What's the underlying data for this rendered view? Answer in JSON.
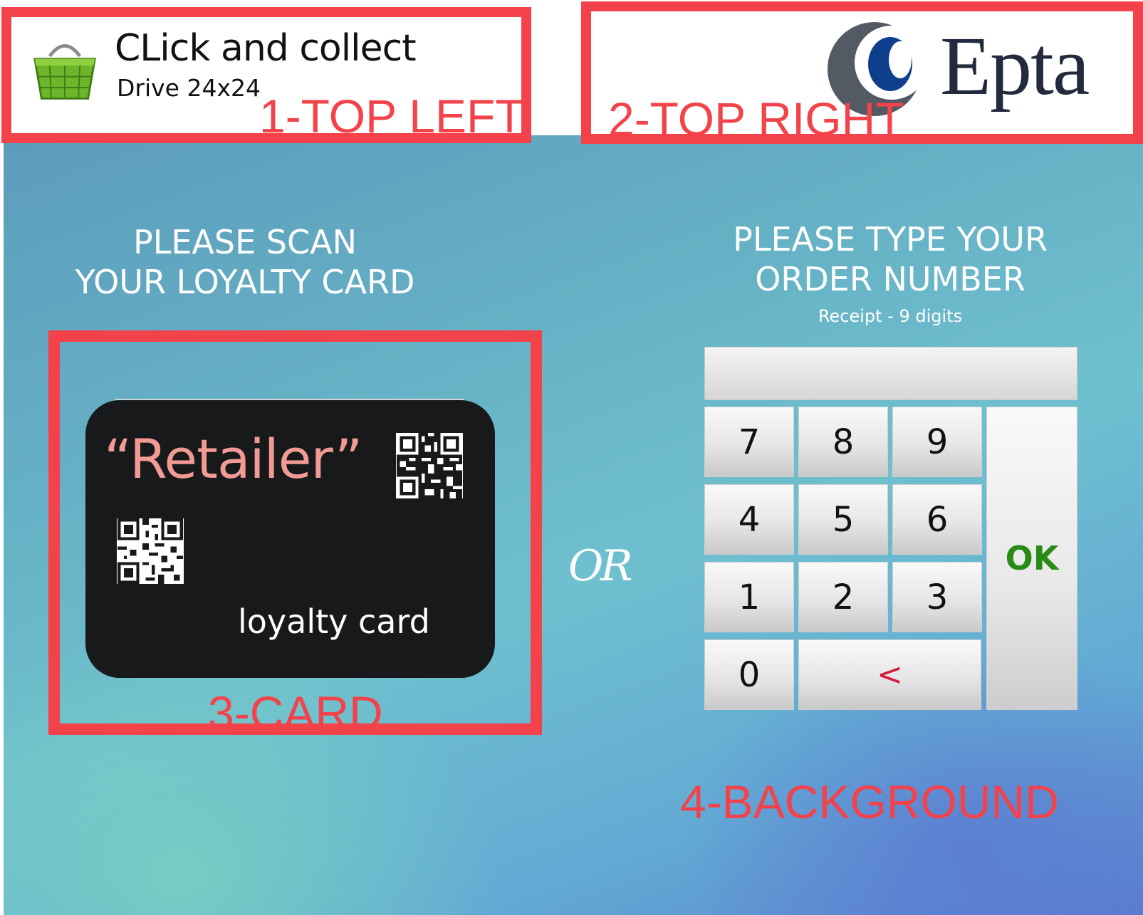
{
  "header": {
    "app_title": "CLick and collect",
    "app_subtitle": "Drive 24x24",
    "brand_name": "Epta"
  },
  "annotations": {
    "top_left": "1-TOP LEFT",
    "top_right": "2-TOP RIGHT",
    "card": "3-CARD",
    "background": "4-BACKGROUND"
  },
  "scan_section": {
    "heading_line1": "PLEASE SCAN",
    "heading_line2": "YOUR LOYALTY CARD",
    "card_brand": "“Retailer”",
    "card_label": "loyalty card"
  },
  "separator": "OR",
  "order_section": {
    "heading_line1": "PLEASE TYPE YOUR",
    "heading_line2": "ORDER NUMBER",
    "hint": "Receipt - 9 digits",
    "input_value": "",
    "keys": {
      "k7": "7",
      "k8": "8",
      "k9": "9",
      "k4": "4",
      "k5": "5",
      "k6": "6",
      "k1": "1",
      "k2": "2",
      "k3": "3",
      "k0": "0",
      "back": "<",
      "ok": "OK"
    }
  },
  "colors": {
    "annotation_red": "#f4424a",
    "ok_green": "#2a8a16",
    "back_red": "#d41b3a",
    "card_text_pink": "#f29a94",
    "brand_navy": "#232a3d"
  }
}
